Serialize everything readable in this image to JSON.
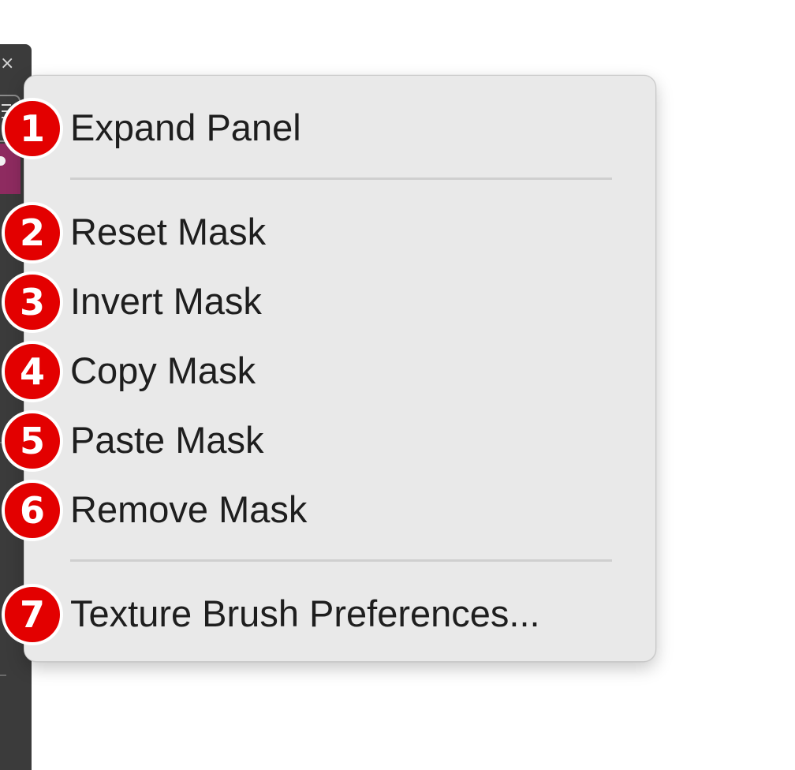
{
  "side_panel": {
    "close_icon": "close-icon",
    "menu_icon": "hamburger-menu-icon",
    "swatch_color": "#8e2b60",
    "panel_color": "#3b3b3b"
  },
  "context_menu": {
    "items": [
      {
        "label": "Expand Panel"
      },
      {
        "label": "Reset Mask"
      },
      {
        "label": "Invert Mask"
      },
      {
        "label": "Copy Mask"
      },
      {
        "label": "Paste Mask"
      },
      {
        "label": "Remove Mask"
      },
      {
        "label": "Texture Brush Preferences..."
      }
    ]
  },
  "annotations": {
    "badge_color": "#e30000",
    "badges": [
      "1",
      "2",
      "3",
      "4",
      "5",
      "6",
      "7"
    ]
  }
}
